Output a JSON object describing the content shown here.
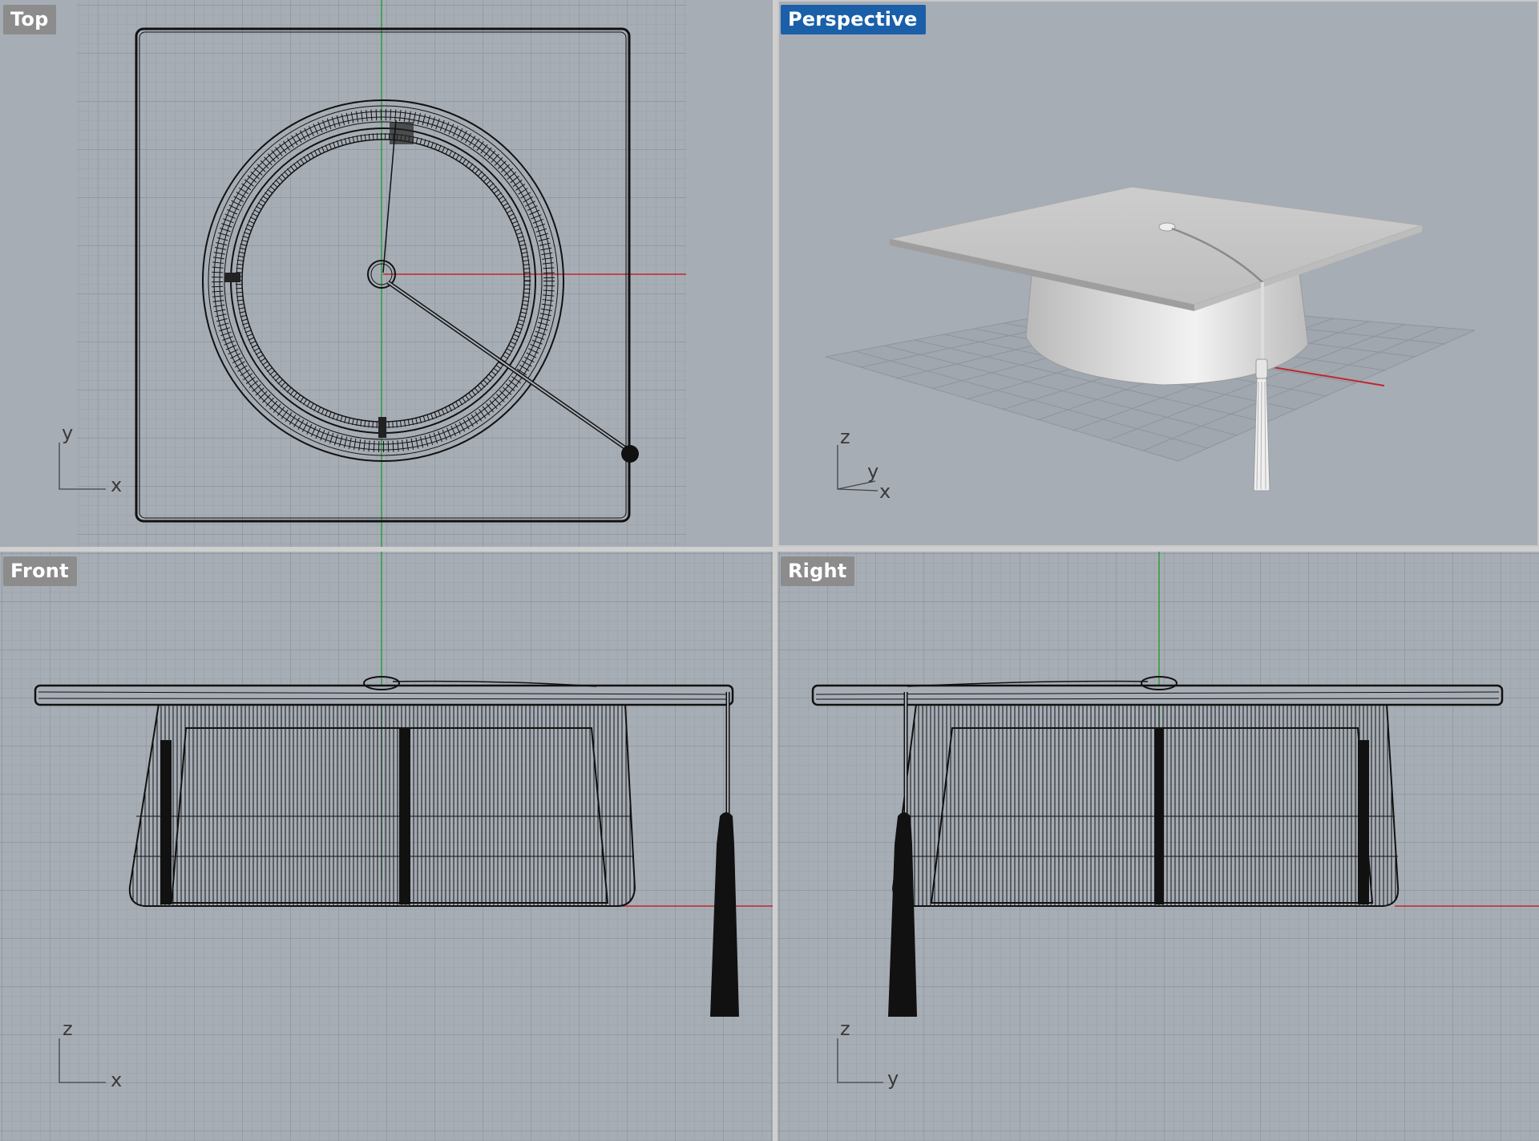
{
  "viewports": {
    "top": {
      "label": "Top",
      "axis_labels": {
        "vertical": "y",
        "horizontal": "x"
      }
    },
    "perspective": {
      "label": "Perspective",
      "axis_labels": {
        "vertical": "z",
        "depth": "y",
        "horizontal": "x"
      }
    },
    "front": {
      "label": "Front",
      "axis_labels": {
        "vertical": "z",
        "horizontal": "x"
      }
    },
    "right": {
      "label": "Right",
      "axis_labels": {
        "vertical": "z",
        "horizontal": "y"
      }
    }
  },
  "colors": {
    "viewport_bg": "#a7adb5",
    "grid_minor": "#9aa0a8",
    "grid_major": "#8e949c",
    "x_axis": "#c0272d",
    "y_axis": "#2e9c3a",
    "wire": "#111111",
    "active_label_bg": "#1a5fa8",
    "inactive_label_bg": "#8c8c8c",
    "shaded_model": "#d2d2d2"
  }
}
